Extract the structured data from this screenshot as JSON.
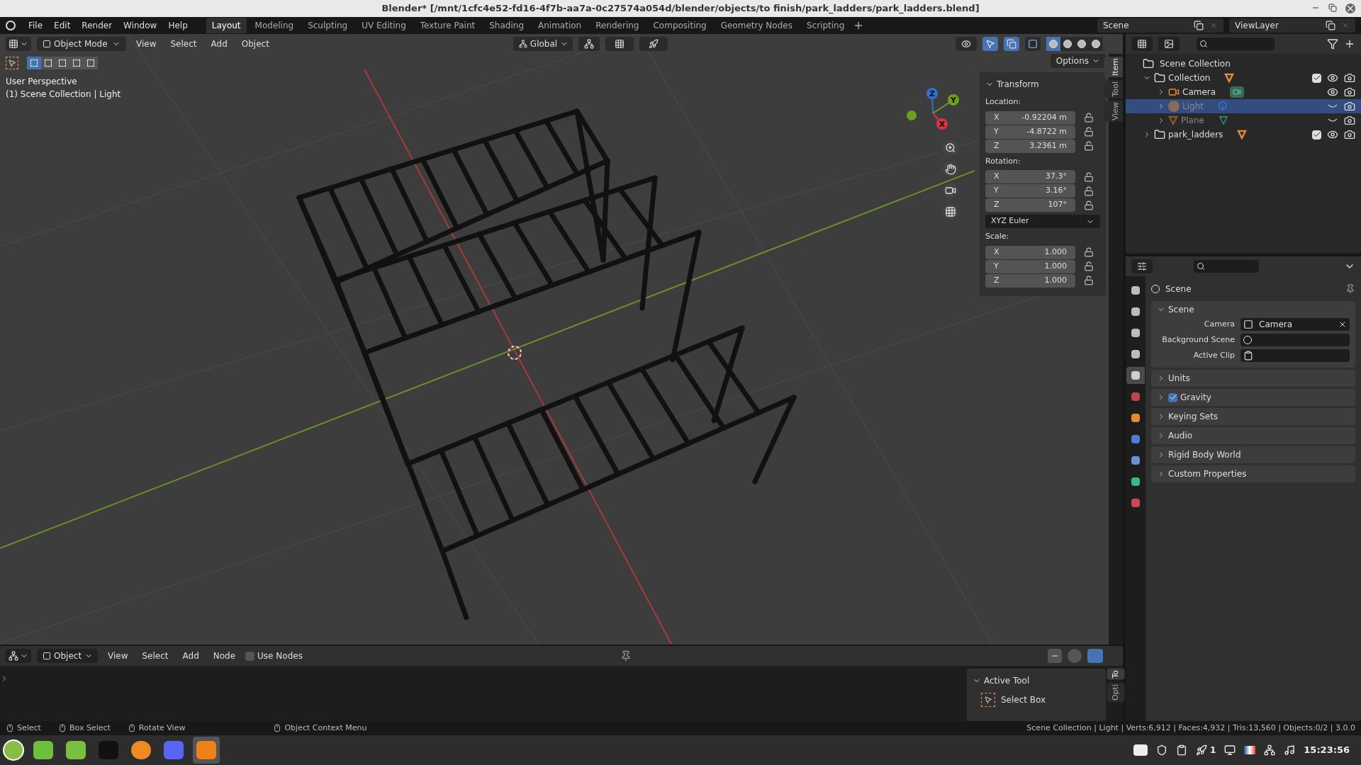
{
  "window": {
    "title": "Blender* [/mnt/1cfc4e52-fd16-4f7b-aa7a-0c27574a054d/blender/objects/to finish/park_ladders/park_ladders.blend]"
  },
  "menu": [
    "File",
    "Edit",
    "Render",
    "Window",
    "Help"
  ],
  "workspaces": [
    {
      "label": "Layout",
      "selected": true
    },
    {
      "label": "Modeling",
      "selected": false
    },
    {
      "label": "Sculpting",
      "selected": false
    },
    {
      "label": "UV Editing",
      "selected": false
    },
    {
      "label": "Texture Paint",
      "selected": false
    },
    {
      "label": "Shading",
      "selected": false
    },
    {
      "label": "Animation",
      "selected": false
    },
    {
      "label": "Rendering",
      "selected": false
    },
    {
      "label": "Compositing",
      "selected": false
    },
    {
      "label": "Geometry Nodes",
      "selected": false
    },
    {
      "label": "Scripting",
      "selected": false
    }
  ],
  "scene": {
    "value": "Scene"
  },
  "view_layer": {
    "value": "ViewLayer"
  },
  "viewport": {
    "mode": "Object Mode",
    "menus": [
      "View",
      "Select",
      "Add",
      "Object"
    ],
    "orientation": "Global",
    "options": "Options",
    "select_modes": [
      {
        "selected": true
      },
      {
        "selected": false
      },
      {
        "selected": false
      },
      {
        "selected": false
      },
      {
        "selected": false
      }
    ],
    "shading": [
      {
        "selected": true
      },
      {
        "selected": false
      },
      {
        "selected": false
      },
      {
        "selected": false
      }
    ],
    "info": [
      "User Perspective",
      "(1) Scene Collection | Light"
    ],
    "gizmo": [
      {
        "label": "Z",
        "color": "#2e72d2"
      },
      {
        "label": "Y",
        "color": "#6f9e1a"
      },
      {
        "label": "X",
        "color": "#d8343f"
      }
    ]
  },
  "sidebar": {
    "tabs": [
      {
        "label": "Item",
        "selected": true
      },
      {
        "label": "Tool",
        "selected": false
      },
      {
        "label": "View",
        "selected": false
      }
    ],
    "transform": {
      "title": "Transform",
      "groups": [
        {
          "label": "Location:",
          "fields": [
            {
              "axis": "X",
              "value": "-0.92204 m"
            },
            {
              "axis": "Y",
              "value": "-4.8722 m"
            },
            {
              "axis": "Z",
              "value": "3.2361 m"
            }
          ]
        },
        {
          "label": "Rotation:",
          "fields": [
            {
              "axis": "X",
              "value": "37.3°"
            },
            {
              "axis": "Y",
              "value": "3.16°"
            },
            {
              "axis": "Z",
              "value": "107°"
            }
          ],
          "dropdown": "XYZ Euler"
        },
        {
          "label": "Scale:",
          "fields": [
            {
              "axis": "X",
              "value": "1.000"
            },
            {
              "axis": "Y",
              "value": "1.000"
            },
            {
              "axis": "Z",
              "value": "1.000"
            }
          ]
        }
      ]
    }
  },
  "outliner": {
    "root": "Scene Collection",
    "items": [
      {
        "label": "Collection",
        "kind": "collection",
        "expanded": true,
        "checked": true,
        "hidden": false,
        "selected": false,
        "children": [
          {
            "label": "Camera",
            "kind": "camera",
            "expanded": false,
            "hidden": false,
            "selected": false
          },
          {
            "label": "Light",
            "kind": "light",
            "expanded": false,
            "hidden": true,
            "selected": true
          },
          {
            "label": "Plane",
            "kind": "mesh",
            "expanded": false,
            "hidden": true,
            "selected": false
          }
        ]
      },
      {
        "label": "park_ladders",
        "kind": "collection",
        "expanded": false,
        "checked": true,
        "hidden": false,
        "selected": false
      }
    ]
  },
  "properties": {
    "context": "Scene",
    "tabs": [
      {
        "color": "#bdbdbd",
        "selected": false
      },
      {
        "color": "#bdbdbd",
        "selected": false
      },
      {
        "color": "#bdbdbd",
        "selected": false
      },
      {
        "color": "#bdbdbd",
        "selected": false
      },
      {
        "color": "#d0d0d0",
        "selected": true
      },
      {
        "color": "#c0444f",
        "selected": false
      },
      {
        "color": "#e08a3a",
        "selected": false
      },
      {
        "color": "#4a7fd6",
        "selected": false
      },
      {
        "color": "#6a8fd8",
        "selected": false
      },
      {
        "color": "#3fb58a",
        "selected": false
      },
      {
        "color": "#c84a5a",
        "selected": false
      }
    ],
    "panels": [
      {
        "title": "Scene",
        "kind": "plain",
        "expanded": true,
        "fields": [
          {
            "label": "Camera",
            "kind": "object",
            "value": "Camera"
          },
          {
            "label": "Background Scene",
            "kind": "scene"
          },
          {
            "label": "Active Clip",
            "kind": "clip"
          }
        ]
      },
      {
        "title": "Units",
        "kind": "plain",
        "expanded": false
      },
      {
        "title": "Gravity",
        "kind": "checkbox",
        "checked": true,
        "expanded": false
      },
      {
        "title": "Keying Sets",
        "kind": "plain",
        "expanded": false
      },
      {
        "title": "Audio",
        "kind": "plain",
        "expanded": false
      },
      {
        "title": "Rigid Body World",
        "kind": "plain",
        "expanded": false
      },
      {
        "title": "Custom Properties",
        "kind": "plain",
        "expanded": false
      }
    ]
  },
  "node_editor": {
    "object": "Object",
    "menus": [
      "View",
      "Select",
      "Add",
      "Node"
    ],
    "use_nodes": {
      "label": "Use Nodes",
      "checked": false
    },
    "active_tool": {
      "title": "Active Tool",
      "tool": "Select Box"
    },
    "tabs": [
      {
        "label": "To",
        "selected": true
      },
      {
        "label": "Opti",
        "selected": false
      }
    ]
  },
  "status_bar": {
    "hints": [
      "Select",
      "Box Select",
      "Rotate View",
      "Object Context Menu"
    ],
    "info": "Scene Collection | Light | Verts:6,912 | Faces:4,932 | Tris:13,560 | Objects:0/2 | 3.0.0"
  },
  "taskbar": {
    "apps": [
      {
        "selected": false
      },
      {
        "selected": false
      },
      {
        "selected": false
      },
      {
        "selected": false
      },
      {
        "selected": false
      },
      {
        "selected": true
      }
    ],
    "tray_count": "1",
    "clock": "15:23:56"
  }
}
